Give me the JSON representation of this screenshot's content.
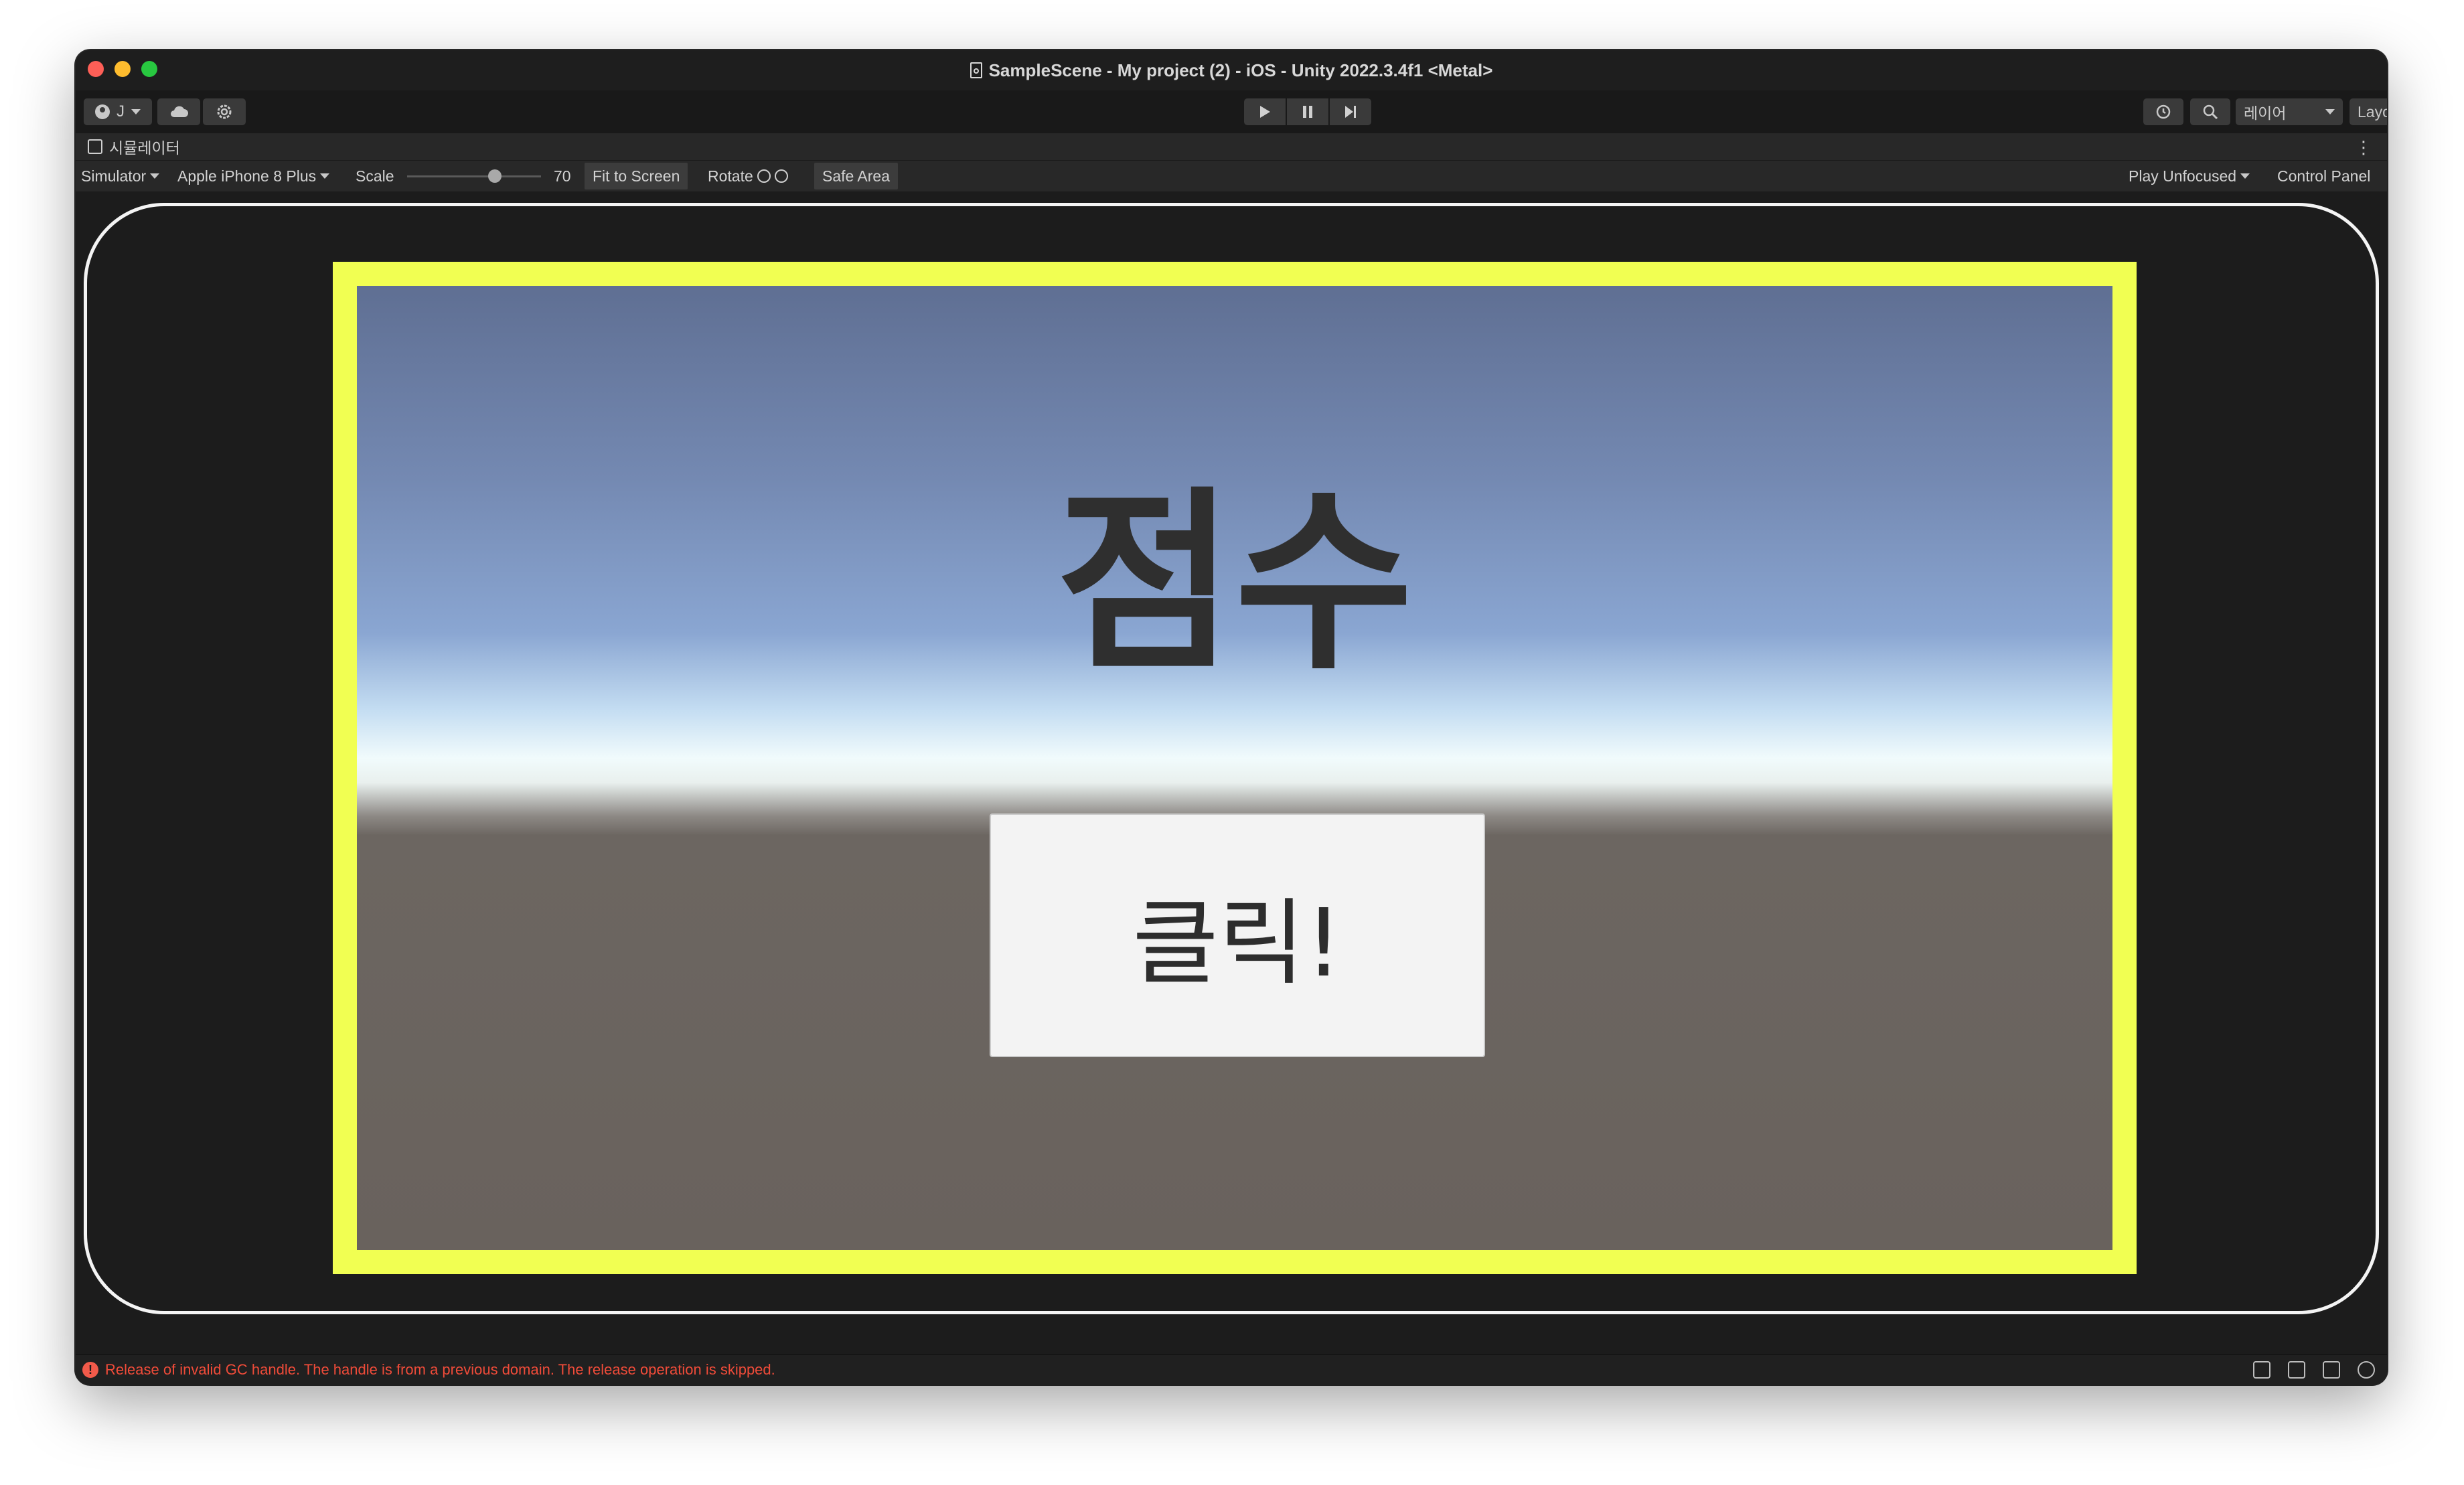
{
  "window": {
    "title": "SampleScene - My project (2) - iOS - Unity 2022.3.4f1 <Metal>"
  },
  "toolbar": {
    "account_label": "J",
    "layers_label": "레이어",
    "layout_label": "Layout"
  },
  "simulator": {
    "tab_label": "시뮬레이터",
    "mode_label": "Simulator",
    "device_label": "Apple iPhone 8 Plus",
    "scale_label": "Scale",
    "scale_value": "70",
    "scale_fraction": 0.7,
    "fit_label": "Fit to Screen",
    "rotate_label": "Rotate",
    "safe_area_label": "Safe Area",
    "play_mode_label": "Play Unfocused",
    "control_panel_label": "Control Panel"
  },
  "game": {
    "score_text": "점수",
    "button_text": "클릭!"
  },
  "status": {
    "error_icon": "!",
    "message": "Release of invalid GC handle. The handle is from a previous domain. The release operation is skipped."
  },
  "colors": {
    "safe_area_border": "#f1ff52",
    "error_text": "#ef4b39",
    "window_bg": "#191919"
  }
}
